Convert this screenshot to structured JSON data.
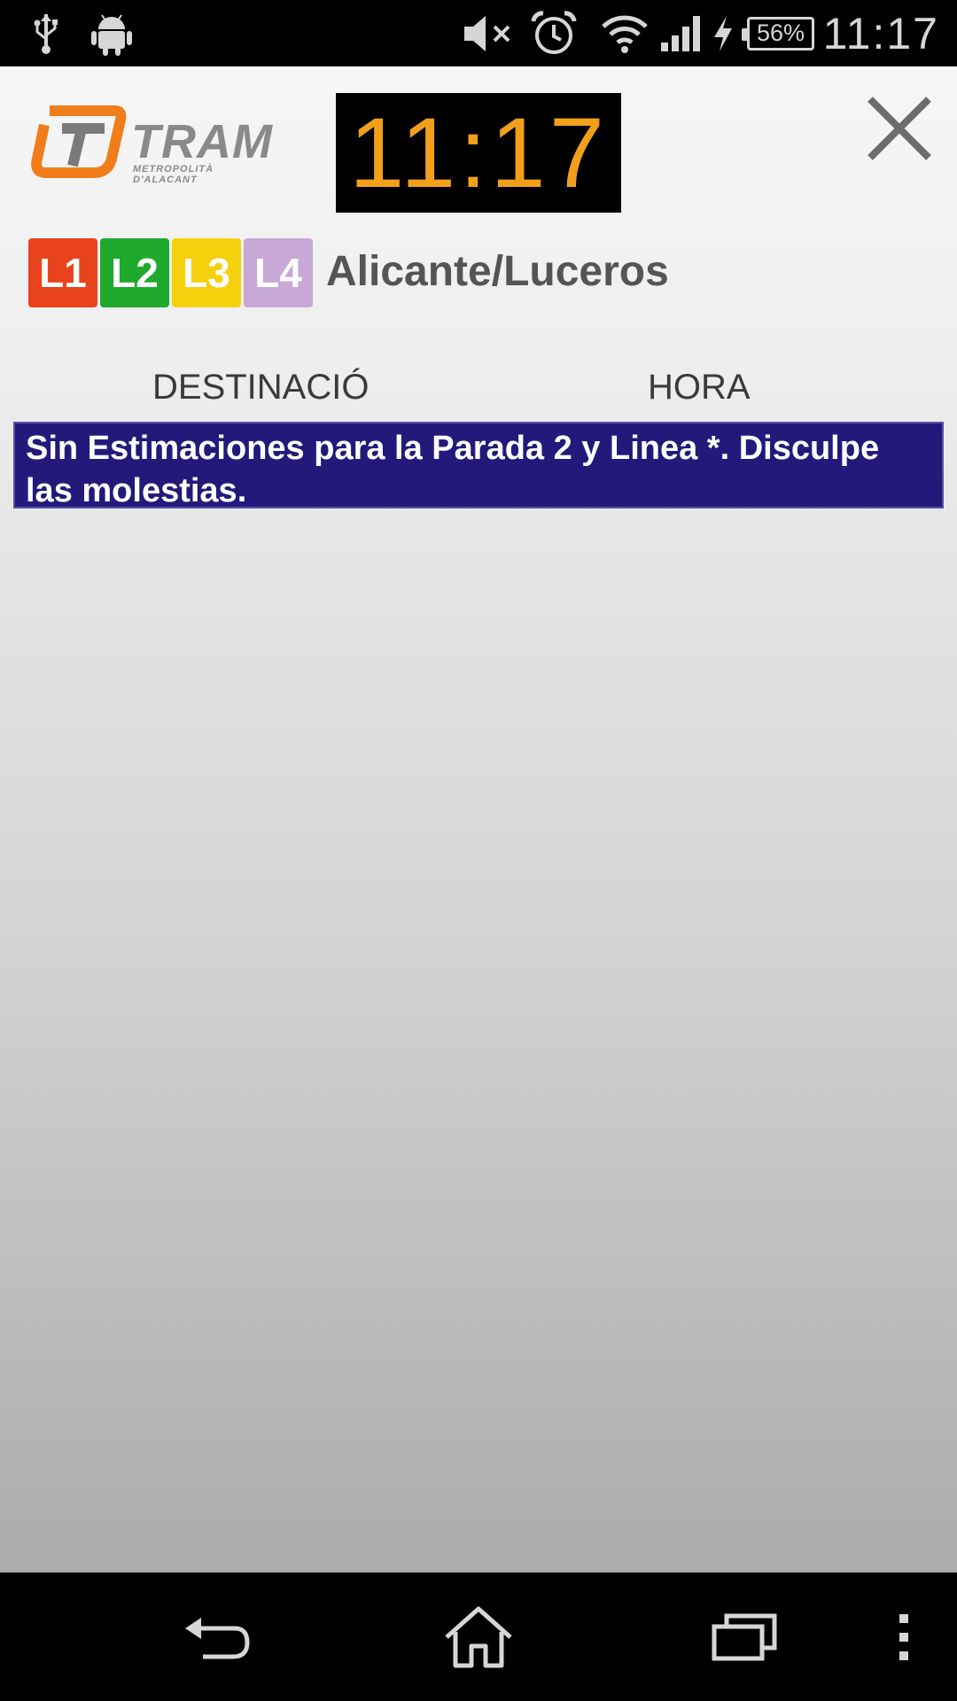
{
  "status_bar": {
    "time": "11:17",
    "battery": "56%",
    "icons": [
      "usb-icon",
      "android-icon",
      "mute-icon",
      "alarm-icon",
      "wifi-icon",
      "signal-icon",
      "charging-icon",
      "battery-icon"
    ]
  },
  "header": {
    "logo_text": "TRAM",
    "logo_subtitle": "METROPOLITÀ D'ALACANT",
    "clock": "11:17"
  },
  "lines": [
    {
      "label": "L1",
      "color": "#e8431c"
    },
    {
      "label": "L2",
      "color": "#1faa2e"
    },
    {
      "label": "L3",
      "color": "#f5d10d"
    },
    {
      "label": "L4",
      "color": "#c7a8d6"
    }
  ],
  "stop": {
    "name": "Alicante/Luceros"
  },
  "table": {
    "col_destination": "DESTINACIÓ",
    "col_time": "HORA"
  },
  "message": "Sin Estimaciones para la Parada 2 y Linea *. Disculpe las molestias.",
  "colors": {
    "clock_text": "#f29f1b",
    "message_bg": "#24197a",
    "logo_orange": "#f07d1a"
  }
}
